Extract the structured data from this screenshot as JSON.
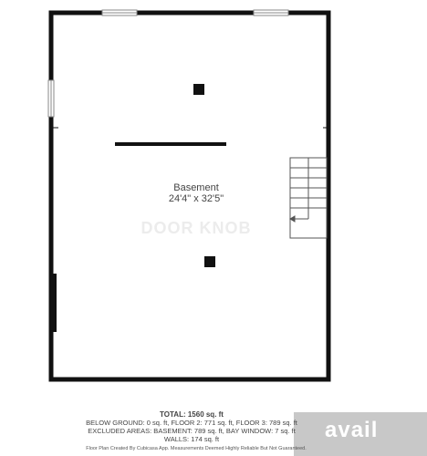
{
  "room": {
    "name": "Basement",
    "dimensions": "24'4\" x 32'5\""
  },
  "watermark": "DOOR KNOB",
  "summary": {
    "total": "TOTAL: 1560 sq. ft",
    "below_ground": "BELOW GROUND: 0 sq. ft, FLOOR 2: 771 sq. ft, FLOOR 3: 789 sq. ft",
    "excluded": "EXCLUDED AREAS: BASEMENT: 789 sq. ft, BAY WINDOW: 7 sq. ft",
    "walls": "WALLS: 174 sq. ft"
  },
  "disclaimer": "Floor Plan Created By Cubicasa App. Measurements Deemed Highly Reliable But Not Guaranteed.",
  "logo": {
    "text": "avail",
    "color": "#c8c8c8"
  },
  "colors": {
    "wall": "#111111",
    "stairs": "#555555"
  }
}
